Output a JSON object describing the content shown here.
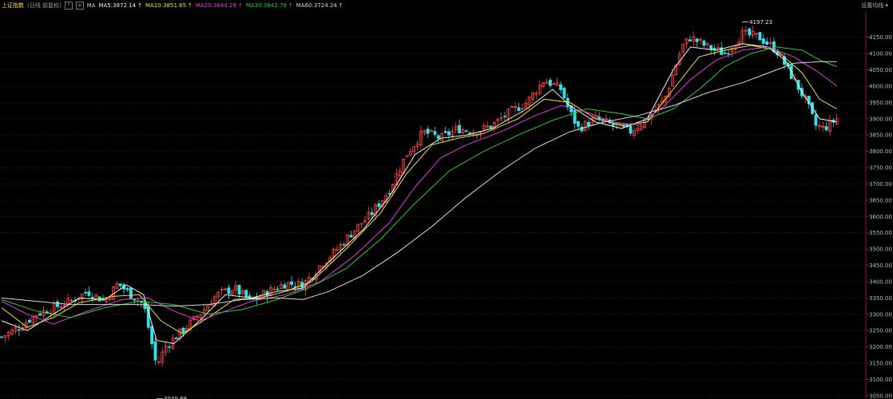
{
  "header": {
    "index_name": "上证指数",
    "period": "(日线 前复权)",
    "help": "?",
    "ma_label": "MA",
    "ma5": "MA5:3872.14",
    "ma10": "MA10:3851.65",
    "ma20": "MA20:3844.29",
    "ma30": "MA30:3842.79",
    "ma60": "MA60:3724.24",
    "arrow": "↑",
    "settings": "设置均线"
  },
  "colors": {
    "up": "#ff4a4a",
    "down": "#33e0e6",
    "ma5": "#f2f2f2",
    "ma10": "#e8e43a",
    "ma20": "#e03ce0",
    "ma30": "#2fcc2f",
    "ma60": "#d9d9d9",
    "grid": "#6b1414",
    "background": "#000000"
  },
  "chart_data": {
    "type": "candlestick",
    "ylim": [
      3040,
      4230
    ],
    "y_ticks": [
      "4150.00",
      "4100.00",
      "4050.00",
      "4000.00",
      "3950.00",
      "3900.00",
      "3850.00",
      "3800.00",
      "3750.00",
      "3700.00",
      "3650.00",
      "3600.00",
      "3550.00",
      "3500.00",
      "3450.00",
      "3400.00",
      "3350.00",
      "3300.00",
      "3250.00",
      "3200.00",
      "3150.00",
      "3100.00",
      "3050.00"
    ],
    "y_tick_values": [
      4150,
      4100,
      4050,
      4000,
      3950,
      3900,
      3850,
      3800,
      3750,
      3700,
      3650,
      3600,
      3550,
      3500,
      3450,
      3400,
      3350,
      3300,
      3250,
      3200,
      3150,
      3100,
      3050
    ],
    "high_marker": {
      "label": "4197.23",
      "value": 4197.23,
      "bar": 0.86
    },
    "low_marker": {
      "label": "3040.69",
      "value": 3040.69,
      "bar": 0.18
    },
    "close_path": [
      [
        0.0,
        3230
      ],
      [
        0.02,
        3260
      ],
      [
        0.04,
        3300
      ],
      [
        0.06,
        3320
      ],
      [
        0.08,
        3340
      ],
      [
        0.1,
        3370
      ],
      [
        0.12,
        3340
      ],
      [
        0.135,
        3395
      ],
      [
        0.15,
        3360
      ],
      [
        0.165,
        3330
      ],
      [
        0.18,
        3140
      ],
      [
        0.19,
        3200
      ],
      [
        0.21,
        3250
      ],
      [
        0.23,
        3300
      ],
      [
        0.25,
        3360
      ],
      [
        0.27,
        3380
      ],
      [
        0.29,
        3340
      ],
      [
        0.31,
        3370
      ],
      [
        0.33,
        3395
      ],
      [
        0.35,
        3390
      ],
      [
        0.37,
        3450
      ],
      [
        0.39,
        3500
      ],
      [
        0.41,
        3560
      ],
      [
        0.43,
        3610
      ],
      [
        0.45,
        3680
      ],
      [
        0.47,
        3790
      ],
      [
        0.49,
        3860
      ],
      [
        0.51,
        3840
      ],
      [
        0.53,
        3870
      ],
      [
        0.55,
        3860
      ],
      [
        0.57,
        3880
      ],
      [
        0.59,
        3920
      ],
      [
        0.61,
        3950
      ],
      [
        0.63,
        4020
      ],
      [
        0.65,
        3990
      ],
      [
        0.66,
        3920
      ],
      [
        0.67,
        3870
      ],
      [
        0.69,
        3900
      ],
      [
        0.71,
        3880
      ],
      [
        0.73,
        3860
      ],
      [
        0.75,
        3900
      ],
      [
        0.77,
        3960
      ],
      [
        0.79,
        4120
      ],
      [
        0.8,
        4150
      ],
      [
        0.82,
        4120
      ],
      [
        0.84,
        4100
      ],
      [
        0.86,
        4160
      ],
      [
        0.88,
        4150
      ],
      [
        0.9,
        4110
      ],
      [
        0.92,
        4020
      ],
      [
        0.935,
        3950
      ],
      [
        0.945,
        3880
      ],
      [
        0.955,
        3870
      ],
      [
        0.97,
        3900
      ]
    ],
    "ma_series": [
      {
        "name": "MA5",
        "color": "#f2f2f2",
        "path": [
          [
            0.0,
            3280
          ],
          [
            0.03,
            3250
          ],
          [
            0.06,
            3300
          ],
          [
            0.09,
            3350
          ],
          [
            0.12,
            3345
          ],
          [
            0.145,
            3390
          ],
          [
            0.165,
            3360
          ],
          [
            0.18,
            3220
          ],
          [
            0.2,
            3210
          ],
          [
            0.23,
            3280
          ],
          [
            0.26,
            3360
          ],
          [
            0.29,
            3350
          ],
          [
            0.32,
            3370
          ],
          [
            0.35,
            3380
          ],
          [
            0.38,
            3460
          ],
          [
            0.42,
            3560
          ],
          [
            0.45,
            3660
          ],
          [
            0.48,
            3790
          ],
          [
            0.51,
            3840
          ],
          [
            0.54,
            3850
          ],
          [
            0.57,
            3870
          ],
          [
            0.61,
            3930
          ],
          [
            0.64,
            3990
          ],
          [
            0.66,
            3940
          ],
          [
            0.69,
            3890
          ],
          [
            0.72,
            3870
          ],
          [
            0.75,
            3900
          ],
          [
            0.78,
            4050
          ],
          [
            0.8,
            4120
          ],
          [
            0.83,
            4110
          ],
          [
            0.86,
            4130
          ],
          [
            0.89,
            4120
          ],
          [
            0.91,
            4080
          ],
          [
            0.93,
            3980
          ],
          [
            0.95,
            3900
          ],
          [
            0.97,
            3890
          ]
        ]
      },
      {
        "name": "MA10",
        "color": "#e8e43a",
        "path": [
          [
            0.0,
            3320
          ],
          [
            0.03,
            3260
          ],
          [
            0.06,
            3290
          ],
          [
            0.09,
            3335
          ],
          [
            0.13,
            3355
          ],
          [
            0.16,
            3360
          ],
          [
            0.185,
            3280
          ],
          [
            0.21,
            3240
          ],
          [
            0.24,
            3290
          ],
          [
            0.27,
            3345
          ],
          [
            0.3,
            3350
          ],
          [
            0.33,
            3370
          ],
          [
            0.36,
            3400
          ],
          [
            0.4,
            3500
          ],
          [
            0.44,
            3610
          ],
          [
            0.47,
            3730
          ],
          [
            0.5,
            3820
          ],
          [
            0.53,
            3840
          ],
          [
            0.56,
            3855
          ],
          [
            0.6,
            3900
          ],
          [
            0.63,
            3960
          ],
          [
            0.66,
            3950
          ],
          [
            0.69,
            3900
          ],
          [
            0.72,
            3880
          ],
          [
            0.75,
            3890
          ],
          [
            0.78,
            3990
          ],
          [
            0.81,
            4090
          ],
          [
            0.84,
            4110
          ],
          [
            0.87,
            4125
          ],
          [
            0.9,
            4110
          ],
          [
            0.93,
            4040
          ],
          [
            0.95,
            3960
          ],
          [
            0.97,
            3930
          ]
        ]
      },
      {
        "name": "MA20",
        "color": "#e03ce0",
        "path": [
          [
            0.0,
            3340
          ],
          [
            0.03,
            3300
          ],
          [
            0.06,
            3270
          ],
          [
            0.1,
            3310
          ],
          [
            0.14,
            3345
          ],
          [
            0.17,
            3350
          ],
          [
            0.2,
            3310
          ],
          [
            0.23,
            3280
          ],
          [
            0.26,
            3310
          ],
          [
            0.29,
            3340
          ],
          [
            0.33,
            3360
          ],
          [
            0.37,
            3400
          ],
          [
            0.41,
            3480
          ],
          [
            0.45,
            3580
          ],
          [
            0.48,
            3690
          ],
          [
            0.51,
            3780
          ],
          [
            0.54,
            3820
          ],
          [
            0.58,
            3860
          ],
          [
            0.62,
            3910
          ],
          [
            0.65,
            3940
          ],
          [
            0.68,
            3920
          ],
          [
            0.71,
            3890
          ],
          [
            0.74,
            3880
          ],
          [
            0.77,
            3940
          ],
          [
            0.8,
            4020
          ],
          [
            0.83,
            4080
          ],
          [
            0.86,
            4110
          ],
          [
            0.89,
            4120
          ],
          [
            0.92,
            4090
          ],
          [
            0.95,
            4040
          ],
          [
            0.97,
            4000
          ]
        ]
      },
      {
        "name": "MA30",
        "color": "#2fcc2f",
        "path": [
          [
            0.0,
            3345
          ],
          [
            0.04,
            3310
          ],
          [
            0.08,
            3290
          ],
          [
            0.12,
            3320
          ],
          [
            0.16,
            3340
          ],
          [
            0.2,
            3330
          ],
          [
            0.24,
            3300
          ],
          [
            0.28,
            3315
          ],
          [
            0.32,
            3345
          ],
          [
            0.36,
            3385
          ],
          [
            0.4,
            3440
          ],
          [
            0.44,
            3530
          ],
          [
            0.48,
            3640
          ],
          [
            0.52,
            3740
          ],
          [
            0.56,
            3800
          ],
          [
            0.6,
            3850
          ],
          [
            0.64,
            3895
          ],
          [
            0.68,
            3930
          ],
          [
            0.72,
            3915
          ],
          [
            0.75,
            3900
          ],
          [
            0.78,
            3930
          ],
          [
            0.81,
            3990
          ],
          [
            0.84,
            4060
          ],
          [
            0.87,
            4100
          ],
          [
            0.9,
            4120
          ],
          [
            0.93,
            4110
          ],
          [
            0.95,
            4080
          ],
          [
            0.97,
            4060
          ]
        ]
      },
      {
        "name": "MA60",
        "color": "#d9d9d9",
        "path": [
          [
            0.0,
            3350
          ],
          [
            0.04,
            3340
          ],
          [
            0.08,
            3330
          ],
          [
            0.12,
            3330
          ],
          [
            0.16,
            3330
          ],
          [
            0.2,
            3325
          ],
          [
            0.24,
            3330
          ],
          [
            0.28,
            3345
          ],
          [
            0.32,
            3350
          ],
          [
            0.35,
            3345
          ],
          [
            0.38,
            3370
          ],
          [
            0.42,
            3420
          ],
          [
            0.46,
            3490
          ],
          [
            0.5,
            3570
          ],
          [
            0.54,
            3660
          ],
          [
            0.58,
            3740
          ],
          [
            0.62,
            3810
          ],
          [
            0.66,
            3860
          ],
          [
            0.7,
            3890
          ],
          [
            0.74,
            3910
          ],
          [
            0.78,
            3940
          ],
          [
            0.82,
            3980
          ],
          [
            0.86,
            4010
          ],
          [
            0.89,
            4040
          ],
          [
            0.92,
            4070
          ],
          [
            0.95,
            4075
          ],
          [
            0.97,
            4075
          ]
        ]
      }
    ]
  }
}
